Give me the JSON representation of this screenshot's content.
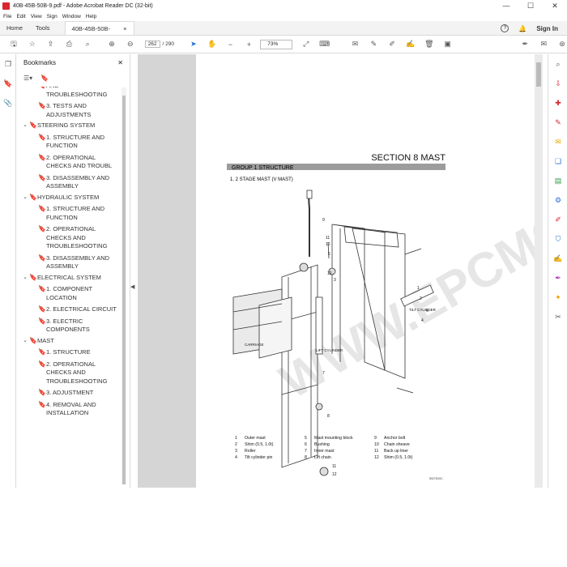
{
  "window": {
    "title": "40B-45B-50B-9.pdf - Adobe Acrobat Reader DC (32-bit)",
    "min": "—",
    "max": "☐",
    "close": "✕"
  },
  "menu": [
    "File",
    "Edit",
    "View",
    "Sign",
    "Window",
    "Help"
  ],
  "tabs": {
    "home": "Home",
    "tools": "Tools",
    "doc": "40B-45B-50B-9.pdf",
    "doc_close": "×",
    "help": "?",
    "bell": "🔔",
    "signin": "Sign In"
  },
  "toolbar": {
    "page_current": "262",
    "page_total": "/ 290",
    "zoom": "73%"
  },
  "bookmarks": {
    "title": "Bookmarks",
    "close": "✕",
    "items": [
      {
        "level": 2,
        "text": "AND TROUBLESHOOTING"
      },
      {
        "level": 2,
        "text": "3. TESTS AND ADJUSTMENTS"
      },
      {
        "level": 1,
        "text": "STEERING SYSTEM"
      },
      {
        "level": 2,
        "text": "1. STRUCTURE AND FUNCTION"
      },
      {
        "level": 2,
        "text": "2. OPERATIONAL CHECKS AND TROUBL"
      },
      {
        "level": 2,
        "text": "3. DISASSEMBLY AND ASSEMBLY"
      },
      {
        "level": 1,
        "text": "HYDRAULIC SYSTEM"
      },
      {
        "level": 2,
        "text": "1. STRUCTURE AND FUNCTION"
      },
      {
        "level": 2,
        "text": "2. OPERATIONAL CHECKS AND TROUBLESHOOTING"
      },
      {
        "level": 2,
        "text": "3. DISASSEMBLY AND ASSEMBLY"
      },
      {
        "level": 1,
        "text": "ELECTRICAL SYSTEM"
      },
      {
        "level": 2,
        "text": "1. COMPONENT LOCATION"
      },
      {
        "level": 2,
        "text": "2. ELECTRICAL CIRCUIT"
      },
      {
        "level": 2,
        "text": "3. ELECTRIC COMPONENTS"
      },
      {
        "level": 1,
        "text": "MAST"
      },
      {
        "level": 2,
        "text": "1. STRUCTURE"
      },
      {
        "level": 2,
        "text": "2. OPERATIONAL CHECKS AND TROUBLESHOOTING"
      },
      {
        "level": 2,
        "text": "3. ADJUSTMENT"
      },
      {
        "level": 2,
        "text": "4. REMOVAL AND INSTALLATION"
      }
    ]
  },
  "page": {
    "section": "SECTION  8  MAST",
    "group": "GROUP  1  STRUCTURE",
    "subtitle": "1. 2 STAGE MAST (V MAST)",
    "watermark": "WWW.EPCMO.COM",
    "figure_code": "5027D20C",
    "labels": {
      "tilt_cylinder": "TILT CYLINDER",
      "carriage": "CARRIAGE",
      "lift_cylinder": "LIFT CYLINDER"
    },
    "parts": [
      {
        "n": "1",
        "name": "Outer mast"
      },
      {
        "n": "2",
        "name": "Shim (0.5, 1.0t)"
      },
      {
        "n": "3",
        "name": "Roller"
      },
      {
        "n": "4",
        "name": "Tilt cylinder pin"
      },
      {
        "n": "5",
        "name": "Mast mounting block"
      },
      {
        "n": "6",
        "name": "Bushing"
      },
      {
        "n": "7",
        "name": "Inner mast"
      },
      {
        "n": "8",
        "name": "Lift chain"
      },
      {
        "n": "9",
        "name": "Anchor bolt"
      },
      {
        "n": "10",
        "name": "Chain sheave"
      },
      {
        "n": "11",
        "name": "Back up liner"
      },
      {
        "n": "12",
        "name": "Shim (0.5, 1.0t)"
      }
    ]
  }
}
